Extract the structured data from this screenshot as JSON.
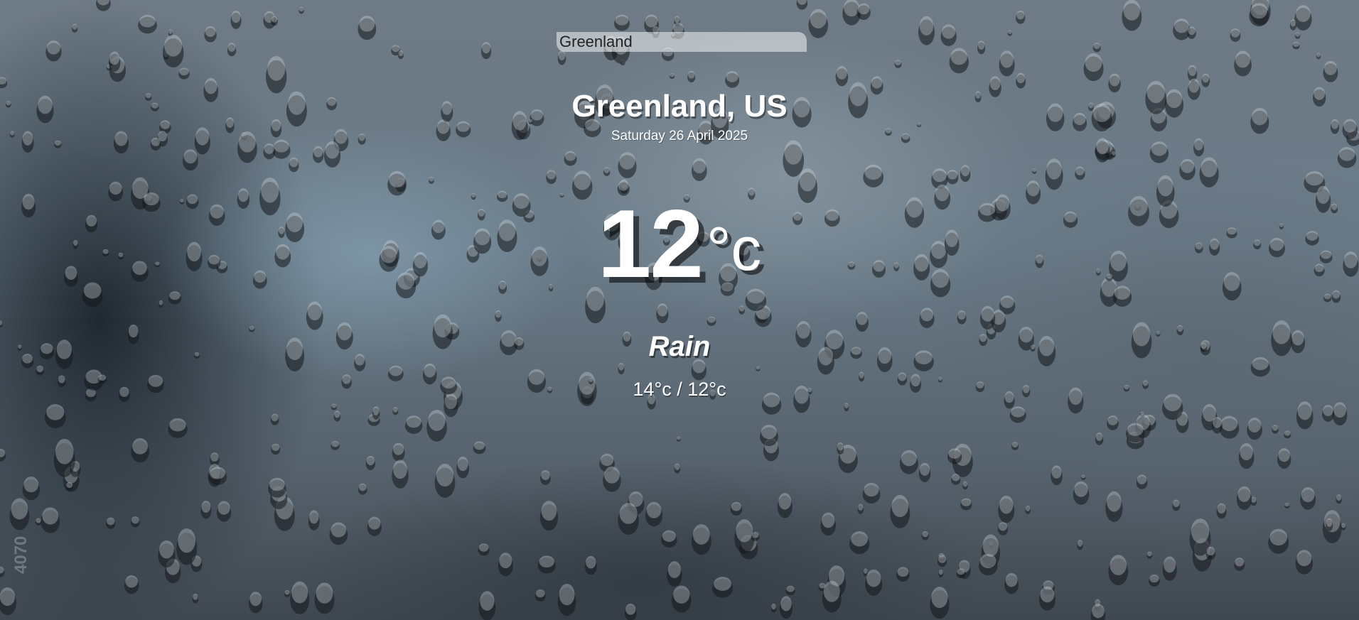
{
  "search": {
    "value": "Greenland"
  },
  "location": {
    "city": "Greenland, US",
    "date": "Saturday 26 April 2025"
  },
  "current": {
    "temperature": "12",
    "unit": "°c",
    "condition": "Rain",
    "hi_low": "14°c / 12°c"
  },
  "watermark": {
    "text": "4070"
  }
}
